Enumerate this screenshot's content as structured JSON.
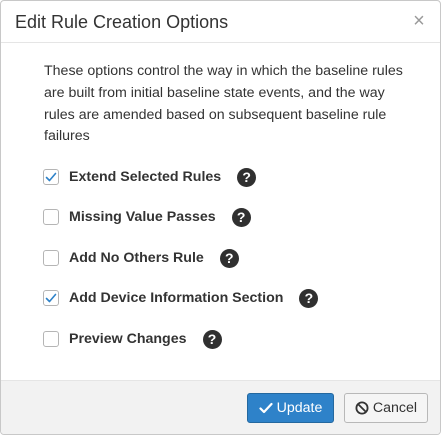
{
  "dialog": {
    "title": "Edit Rule Creation Options",
    "close_glyph": "×",
    "description": "These options control the way in which the baseline rules are built from initial baseline state events, and the way rules are amended based on subsequent baseline rule failures"
  },
  "options": [
    {
      "label": "Extend Selected Rules",
      "checked": true,
      "help_icon": "question-circle-icon"
    },
    {
      "label": "Missing Value Passes",
      "checked": false,
      "help_icon": "question-circle-icon"
    },
    {
      "label": "Add No Others Rule",
      "checked": false,
      "help_icon": "question-circle-icon"
    },
    {
      "label": "Add Device Information Section",
      "checked": true,
      "help_icon": "question-circle-icon"
    },
    {
      "label": "Preview Changes",
      "checked": false,
      "help_icon": "question-circle-icon"
    }
  ],
  "help_glyph": "?",
  "footer": {
    "update_label": "Update",
    "update_icon": "checkmark-icon",
    "cancel_label": "Cancel",
    "cancel_icon": "ban-icon"
  },
  "colors": {
    "primary": "#2e82c9",
    "checkmark": "#2e82c9",
    "footer_bg": "#f2f2f2"
  }
}
